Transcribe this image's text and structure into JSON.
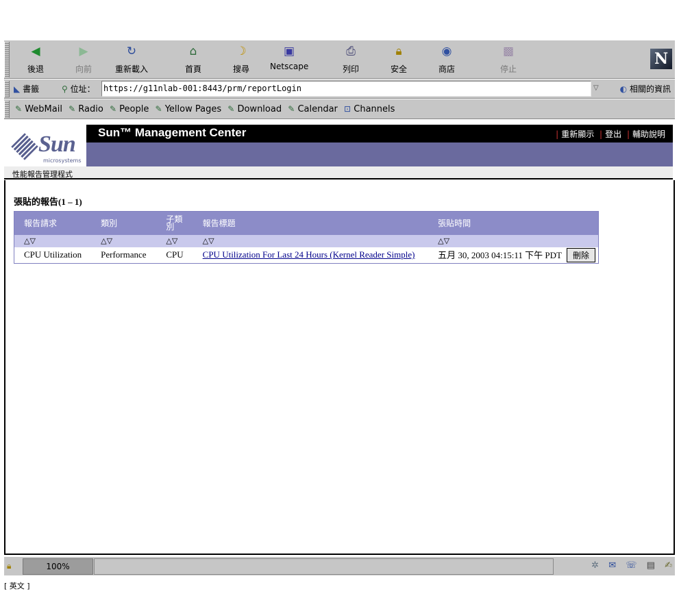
{
  "browser": {
    "nav_buttons": [
      {
        "label": "後退",
        "icon": "back-arrow",
        "glyph": "◀",
        "color": "#1e8a2e"
      },
      {
        "label": "向前",
        "icon": "forward-arrow",
        "glyph": "▶",
        "color": "#8cb894"
      },
      {
        "label": "重新載入",
        "icon": "reload-icon",
        "glyph": "↻",
        "color": "#2a4a9a"
      },
      {
        "label": "首頁",
        "icon": "home-icon",
        "glyph": "⌂",
        "color": "#2e6a3a"
      },
      {
        "label": "搜尋",
        "icon": "search-icon",
        "glyph": "☽",
        "color": "#c09000"
      },
      {
        "label": "Netscape",
        "icon": "netscape-icon",
        "glyph": "▣",
        "color": "#3a3aa0"
      },
      {
        "label": "列印",
        "icon": "print-icon",
        "glyph": "⎙",
        "color": "#404070"
      },
      {
        "label": "安全",
        "icon": "lock-icon",
        "glyph": "🔒",
        "color": "#a08000"
      },
      {
        "label": "商店",
        "icon": "shop-icon",
        "glyph": "◉",
        "color": "#3050a0"
      },
      {
        "label": "停止",
        "icon": "stop-icon",
        "glyph": "▩",
        "color": "#9a8aa8"
      }
    ],
    "bookmarks_label": "書籤",
    "location_label": "位址：",
    "url": "https://g11nlab-001:8443/prm/reportLogin",
    "related_label": "相關的資訊",
    "personal_links": [
      "WebMail",
      "Radio",
      "People",
      "Yellow Pages",
      "Download",
      "Calendar",
      "Channels"
    ]
  },
  "app": {
    "title": "Sun™ Management Center",
    "logo_text": "Sun",
    "logo_sub": "microsystems",
    "links": [
      "重新顯示",
      "登出",
      "輔助說明"
    ],
    "breadcrumb": "性能報告管理程式"
  },
  "report_list": {
    "title": "張貼的報告(1 – 1)",
    "columns": [
      "報告請求",
      "類別",
      "子類別",
      "報告標題",
      "張貼時間"
    ],
    "sort_glyph": "△▽",
    "rows": [
      {
        "request": "CPU Utilization",
        "category": "Performance",
        "subcategory": "CPU",
        "title": "CPU Utilization For Last 24 Hours (Kernel Reader Simple)",
        "posted": "五月 30, 2003 04:15:11 下午 PDT",
        "delete_label": "刪除"
      }
    ]
  },
  "statusbar": {
    "zoom": "100%",
    "status_text": ""
  },
  "footer_note": "[ 英文 ]"
}
